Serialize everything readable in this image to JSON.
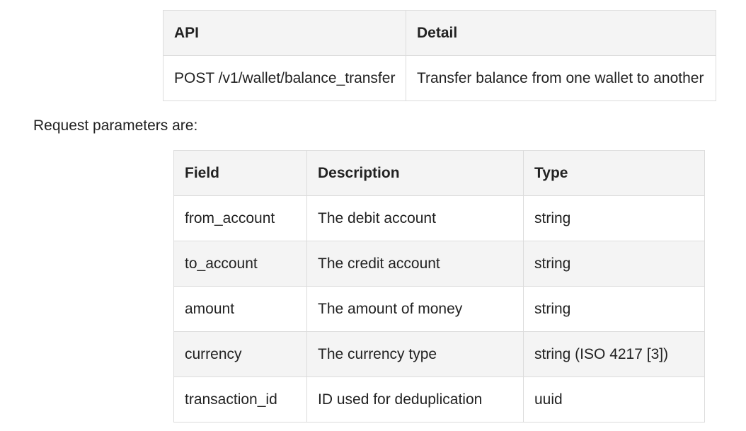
{
  "api_table": {
    "headers": [
      "API",
      "Detail"
    ],
    "rows": [
      [
        "POST /v1/wallet/balance_transfer",
        "Transfer balance from one wallet to another"
      ]
    ]
  },
  "request_params_label": "Request parameters are:",
  "params_table": {
    "headers": [
      "Field",
      "Description",
      "Type"
    ],
    "rows": [
      [
        "from_account",
        "The debit account",
        "string"
      ],
      [
        "to_account",
        "The credit account",
        "string"
      ],
      [
        "amount",
        "The amount of money",
        "string"
      ],
      [
        "currency",
        "The currency type",
        "string (ISO 4217 [3])"
      ],
      [
        "transaction_id",
        "ID used for deduplication",
        "uuid"
      ]
    ]
  }
}
